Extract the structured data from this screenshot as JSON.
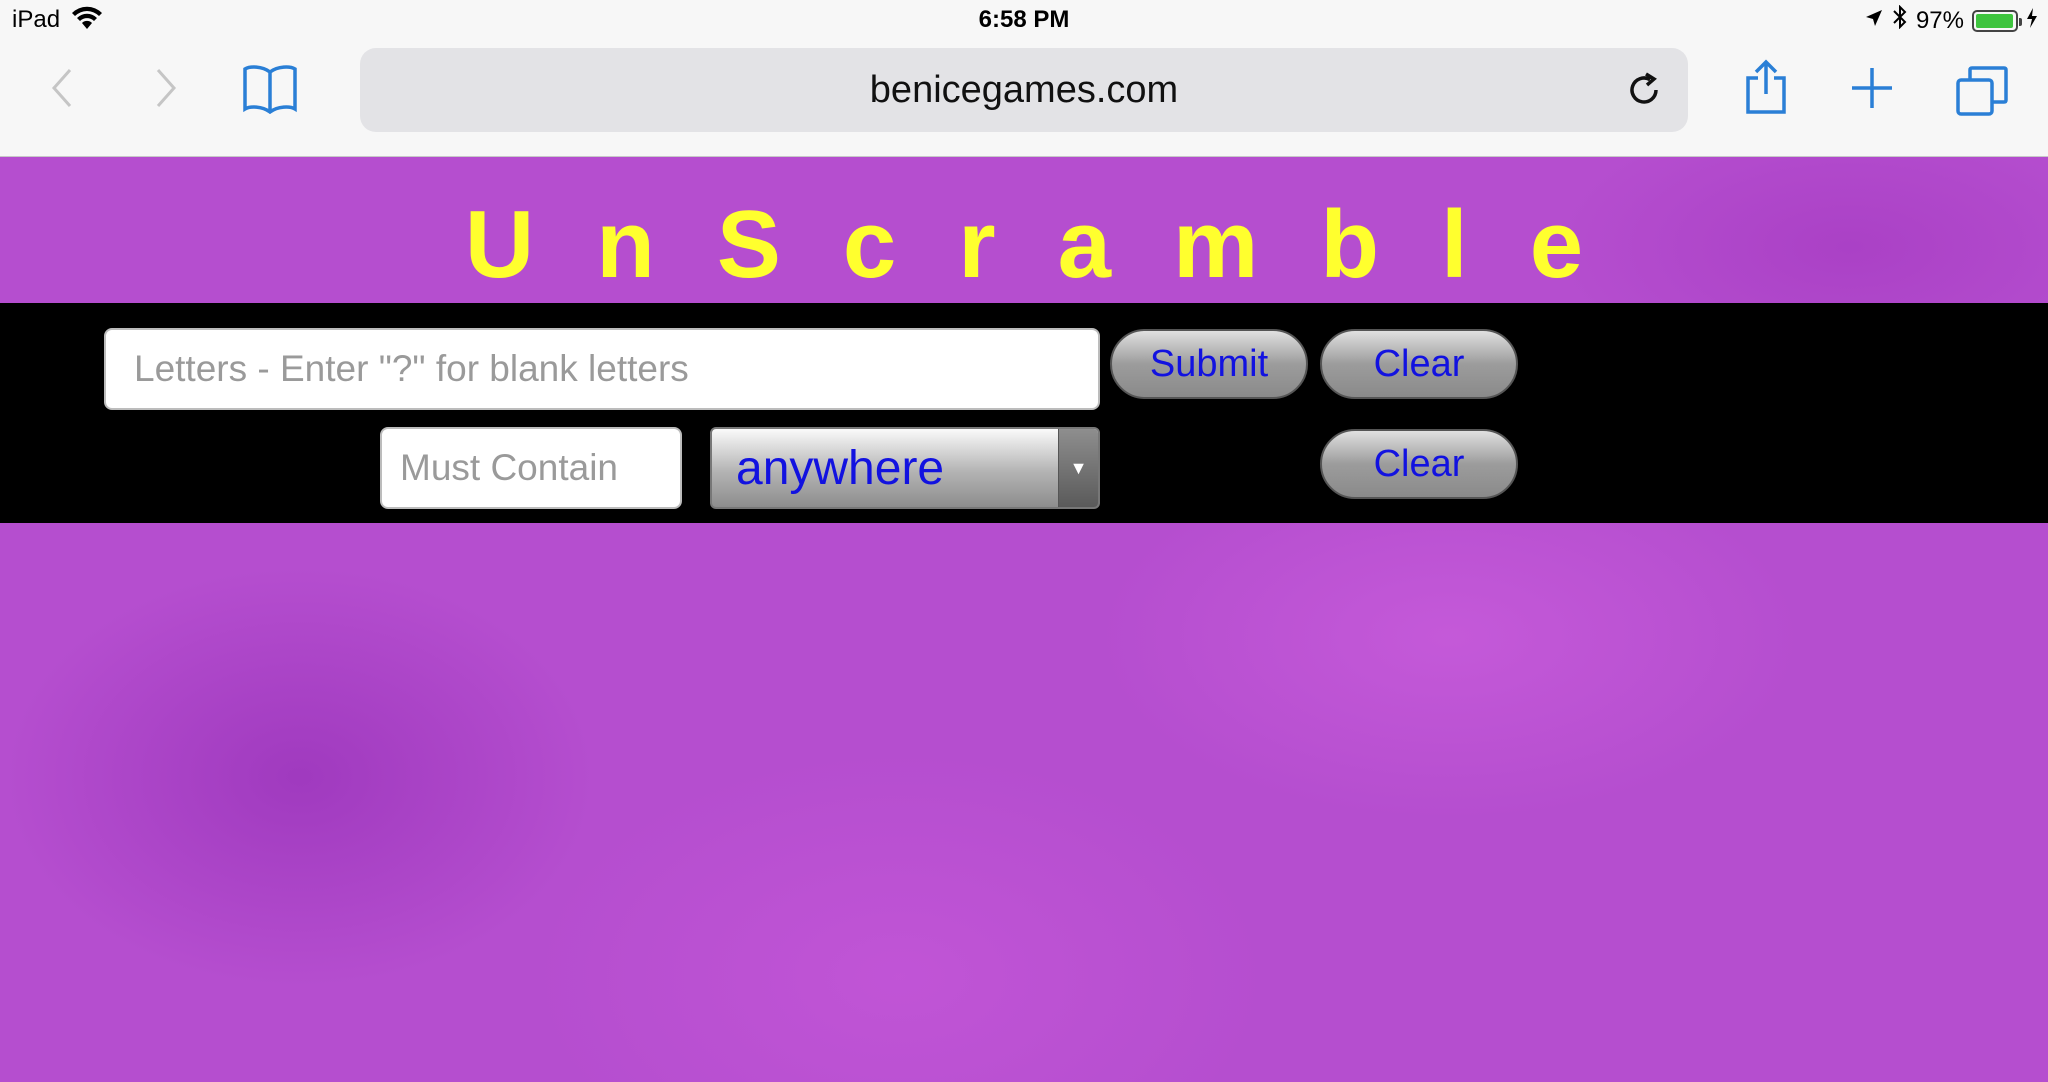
{
  "status_bar": {
    "device": "iPad",
    "time": "6:58 PM",
    "battery": "97%",
    "battery_level": 0.97
  },
  "browser": {
    "url": "benicegames.com",
    "icons": [
      "back-icon",
      "forward-icon",
      "bookmarks-icon",
      "reload-icon",
      "share-icon",
      "new-tab-icon",
      "tabs-icon"
    ]
  },
  "page": {
    "title": "UnScramble",
    "letters_placeholder": "Letters - Enter \"?\" for blank letters",
    "letters_value": "",
    "submit_label": "Submit",
    "clear_label": "Clear",
    "contain_placeholder": "Must Contain",
    "contain_value": "",
    "position_selected": "anywhere",
    "clear2_label": "Clear"
  },
  "colors": {
    "background": "#b54ecf",
    "title": "#ffff2e",
    "band": "#000000",
    "button_text": "#1212e0",
    "ios_blue": "#2a7fd6"
  }
}
